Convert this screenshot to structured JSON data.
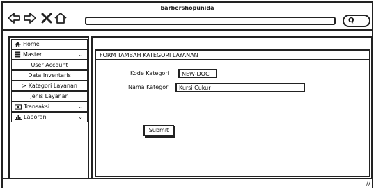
{
  "window": {
    "title": "barbershopunida"
  },
  "sidebar": {
    "items": [
      {
        "label": "Home",
        "icon": "home-icon"
      },
      {
        "label": "Master",
        "icon": "database-icon",
        "chevron": "⌄"
      },
      {
        "label": "User Account"
      },
      {
        "label": "Data Inventaris"
      },
      {
        "label": "Kategori Layanan",
        "prefix": ">"
      },
      {
        "label": "Jenis Layanan"
      },
      {
        "label": "Transaksi",
        "icon": "money-icon",
        "chevron": "⌄"
      },
      {
        "label": "Laporan",
        "icon": "chart-icon",
        "chevron": "⌄"
      }
    ]
  },
  "form": {
    "title": "FORM TAMBAH KATEGORI LAYANAN",
    "kode_label": "Kode Kategori",
    "kode_value": "NEW-DOC",
    "nama_label": "Nama Kategori",
    "nama_value": "Kursi Cukur",
    "submit_label": "Submit"
  }
}
